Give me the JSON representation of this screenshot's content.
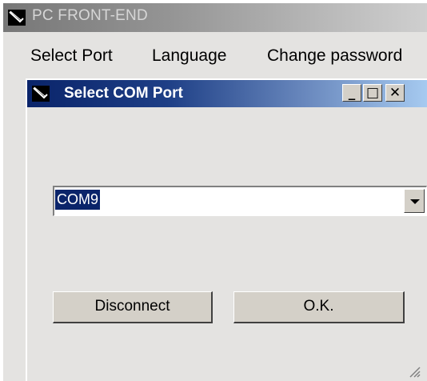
{
  "window": {
    "title": "PC FRONT-END",
    "icon": "app-logo-icon"
  },
  "menu": {
    "items": [
      {
        "label": "Select Port"
      },
      {
        "label": "Language"
      },
      {
        "label": "Change password"
      }
    ]
  },
  "dialog": {
    "title": "Select COM Port",
    "icon": "app-logo-icon",
    "controls": {
      "minimize": "_",
      "maximize": "□",
      "close": "✕"
    },
    "port_select": {
      "value": "COM9",
      "arrow_icon": "chevron-down-icon"
    },
    "buttons": {
      "disconnect_label": "Disconnect",
      "ok_label": "O.K."
    }
  },
  "colors": {
    "dialog_titlebar_start": "#0a246a",
    "dialog_titlebar_end": "#a6caf0",
    "window_background": "#e4e3e1",
    "selection_highlight": "#0a246a"
  }
}
